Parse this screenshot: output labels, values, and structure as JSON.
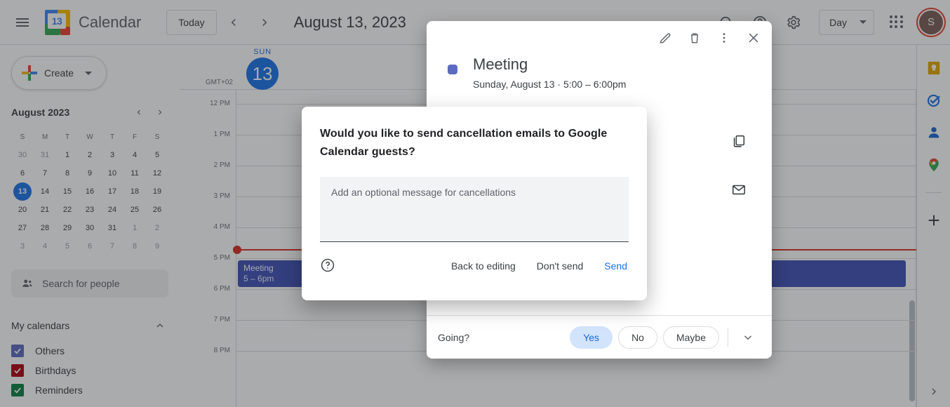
{
  "topbar": {
    "menu_icon": "hamburger-menu-icon",
    "logo_day": "13",
    "brand": "Calendar",
    "today_label": "Today",
    "prev_icon": "chevron-left-icon",
    "next_icon": "chevron-right-icon",
    "date_title": "August 13, 2023",
    "search_icon": "search-icon",
    "help_icon": "help-icon",
    "settings_icon": "gear-icon",
    "view_label": "Day",
    "view_caret": "chevron-down-icon",
    "apps_icon": "apps-grid-icon",
    "avatar_letter": "S"
  },
  "sidebar": {
    "create_label": "Create",
    "create_caret": "chevron-down-icon",
    "mini_calendar": {
      "title": "August 2023",
      "prev_icon": "chevron-left-icon",
      "next_icon": "chevron-right-icon",
      "dow": [
        "S",
        "M",
        "T",
        "W",
        "T",
        "F",
        "S"
      ],
      "weeks": [
        [
          {
            "d": "30",
            "m": true
          },
          {
            "d": "31",
            "m": true
          },
          {
            "d": "1"
          },
          {
            "d": "2"
          },
          {
            "d": "3"
          },
          {
            "d": "4"
          },
          {
            "d": "5"
          }
        ],
        [
          {
            "d": "6"
          },
          {
            "d": "7"
          },
          {
            "d": "8"
          },
          {
            "d": "9"
          },
          {
            "d": "10"
          },
          {
            "d": "11"
          },
          {
            "d": "12"
          }
        ],
        [
          {
            "d": "13",
            "sel": true
          },
          {
            "d": "14"
          },
          {
            "d": "15"
          },
          {
            "d": "16"
          },
          {
            "d": "17"
          },
          {
            "d": "18"
          },
          {
            "d": "19"
          }
        ],
        [
          {
            "d": "20"
          },
          {
            "d": "21"
          },
          {
            "d": "22"
          },
          {
            "d": "23"
          },
          {
            "d": "24"
          },
          {
            "d": "25"
          },
          {
            "d": "26"
          }
        ],
        [
          {
            "d": "27"
          },
          {
            "d": "28"
          },
          {
            "d": "29"
          },
          {
            "d": "30"
          },
          {
            "d": "31"
          },
          {
            "d": "1",
            "m": true
          },
          {
            "d": "2",
            "m": true
          }
        ],
        [
          {
            "d": "3",
            "m": true
          },
          {
            "d": "4",
            "m": true
          },
          {
            "d": "5",
            "m": true
          },
          {
            "d": "6",
            "m": true
          },
          {
            "d": "7",
            "m": true
          },
          {
            "d": "8",
            "m": true
          },
          {
            "d": "9",
            "m": true
          }
        ]
      ]
    },
    "search_people_placeholder": "Search for people",
    "search_people_icon": "people-icon",
    "my_calendars_label": "My calendars",
    "my_calendars_collapse_icon": "chevron-up-icon",
    "calendars": [
      {
        "name": "Others",
        "color": "#5c6bc0",
        "checked": true
      },
      {
        "name": "Birthdays",
        "color": "#b1040e",
        "checked": true
      },
      {
        "name": "Reminders",
        "color": "#0b8043",
        "checked": true
      }
    ]
  },
  "grid": {
    "timezone": "GMT+02",
    "day_of_week": "SUN",
    "day_number": "13",
    "hours": [
      "12 PM",
      "1 PM",
      "2 PM",
      "3 PM",
      "4 PM",
      "5 PM",
      "6 PM",
      "7 PM",
      "8 PM"
    ],
    "now_indicator_color": "#d93025",
    "event": {
      "title": "Meeting",
      "time": "5 – 6pm",
      "color": "#3f51b5"
    }
  },
  "rail": {
    "icons": [
      "keep-icon",
      "tasks-icon",
      "contacts-icon",
      "maps-icon",
      "add-apps-icon"
    ],
    "expand_icon": "chevron-right-icon"
  },
  "event_popup": {
    "edit_icon": "pencil-icon",
    "delete_icon": "trash-icon",
    "more_icon": "more-options-icon",
    "close_icon": "close-icon",
    "color": "#5c6bc0",
    "title": "Meeting",
    "subtitle": "Sunday, August 13  ·  5:00 – 6:00pm",
    "side_icons": [
      "copy-icon",
      "email-icon"
    ],
    "going_label": "Going?",
    "rsvp": [
      {
        "label": "Yes",
        "active": true
      },
      {
        "label": "No",
        "active": false
      },
      {
        "label": "Maybe",
        "active": false
      }
    ],
    "rsvp_more_icon": "chevron-down-icon"
  },
  "dialog": {
    "title": "Would you like to send cancellation emails to Google Calendar guests?",
    "message_placeholder": "Add an optional message for cancellations",
    "message_value": "",
    "help_icon": "help-circle-icon",
    "buttons": [
      {
        "label": "Back to editing",
        "primary": false
      },
      {
        "label": "Don't send",
        "primary": false
      },
      {
        "label": "Send",
        "primary": true
      }
    ],
    "primary_color": "#1a73e8"
  }
}
